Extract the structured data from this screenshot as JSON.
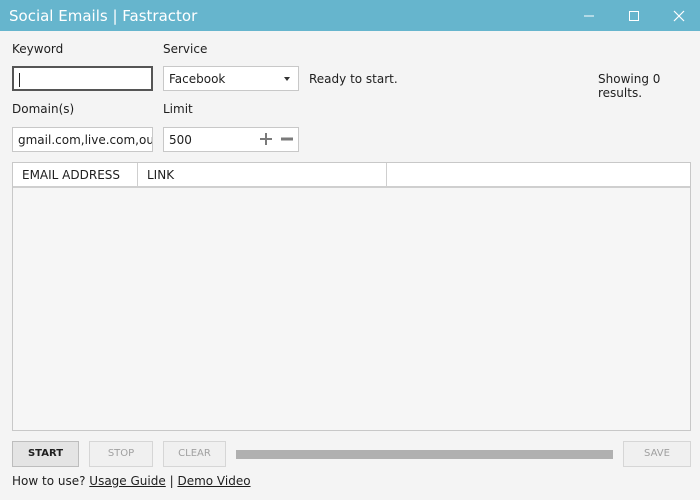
{
  "window": {
    "title": "Social Emails | Fastractor",
    "controls": [
      "minimize-icon",
      "maximize-icon",
      "close-icon"
    ]
  },
  "colors": {
    "titlebar": "#66b5cd",
    "background": "#f4f4f4"
  },
  "form": {
    "keyword_label": "Keyword",
    "keyword_value": "",
    "service_label": "Service",
    "service_value": "Facebook",
    "status_text": "Ready to start.",
    "results_text": "Showing 0 results.",
    "domains_label": "Domain(s)",
    "domains_value": "gmail.com,live.com,outlook",
    "limit_label": "Limit",
    "limit_value": "500"
  },
  "table": {
    "columns": [
      "EMAIL ADDRESS",
      "LINK",
      ""
    ],
    "rows": []
  },
  "buttons": {
    "start": "START",
    "stop": "STOP",
    "clear": "CLEAR",
    "save": "SAVE"
  },
  "progress": {
    "fraction": 0
  },
  "footer": {
    "prefix": "How to use?",
    "usage_guide": "Usage Guide",
    "separator": "|",
    "demo_video": "Demo Video"
  }
}
